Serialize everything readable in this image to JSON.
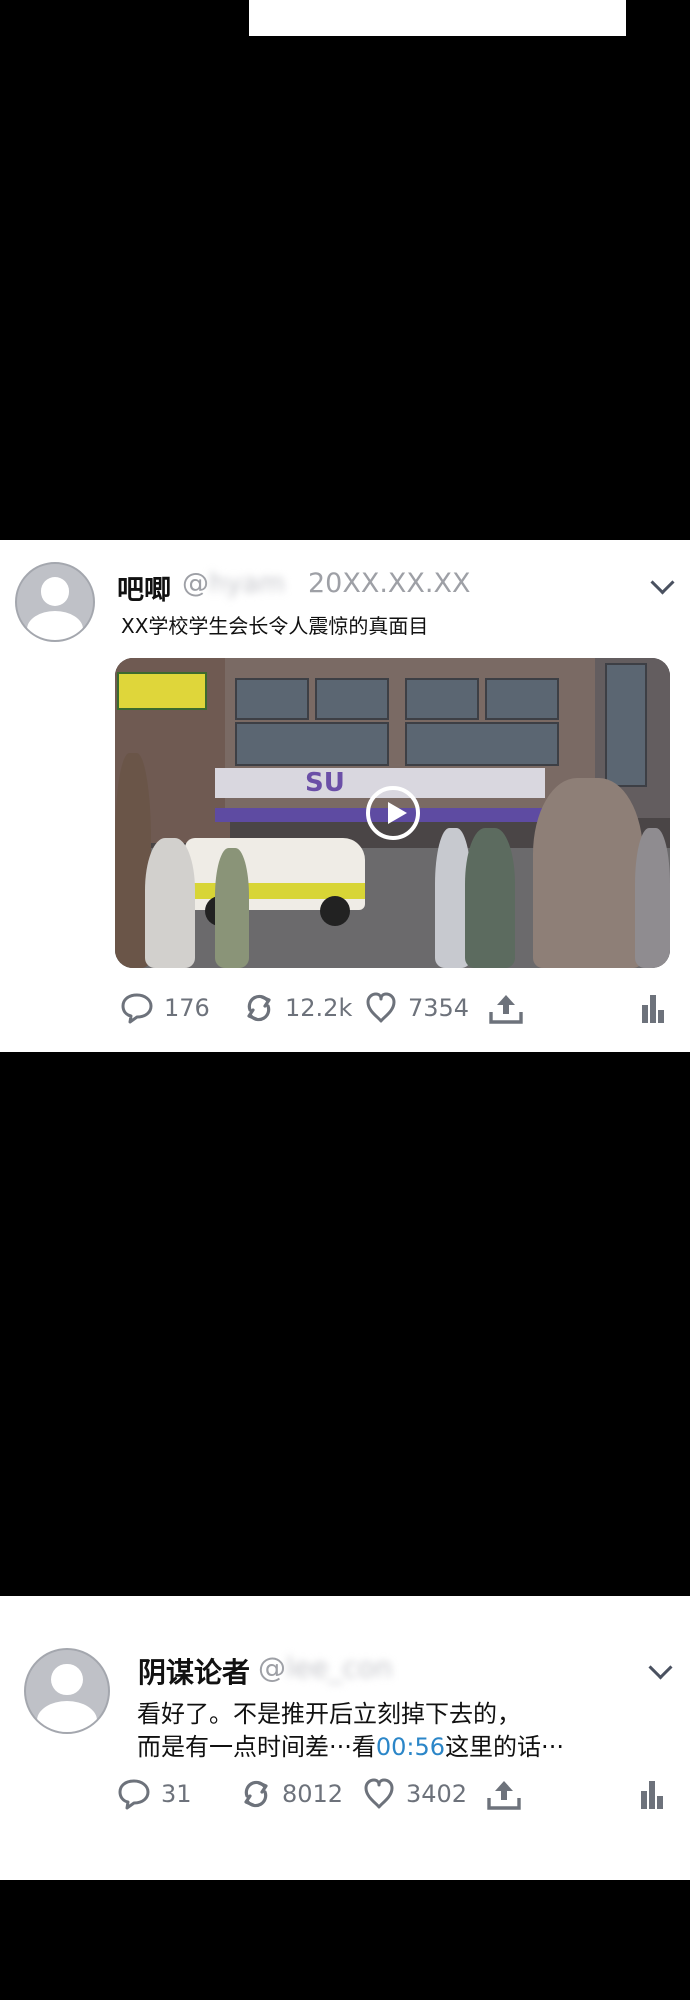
{
  "colors": {
    "background": "#000000",
    "card": "#ffffff",
    "icon_gray": "#6d727b",
    "handle_gray": "#9ea0a6",
    "timestamp_link": "#2b86c8"
  },
  "posts": [
    {
      "name": "吧唧",
      "at": "@",
      "handle_blurred": "hyam",
      "date": "20XX.XX.XX",
      "text": "XX学校学生会长令人震惊的真面目",
      "media": {
        "type": "video",
        "storefront_sign": "SU",
        "play_icon": "play-circle-icon"
      },
      "actions": {
        "replies": "176",
        "retweets": "12.2k",
        "likes": "7354"
      }
    },
    {
      "name": "阴谋论者",
      "at": "@",
      "handle_blurred": "lee_con",
      "text_line1": "看好了。不是推开后立刻掉下去的，",
      "text_line2_before": "而是有一点时间差···看",
      "text_line2_link": "00:56",
      "text_line2_after": "这里的话···",
      "actions": {
        "replies": "31",
        "retweets": "8012",
        "likes": "3402"
      }
    }
  ]
}
